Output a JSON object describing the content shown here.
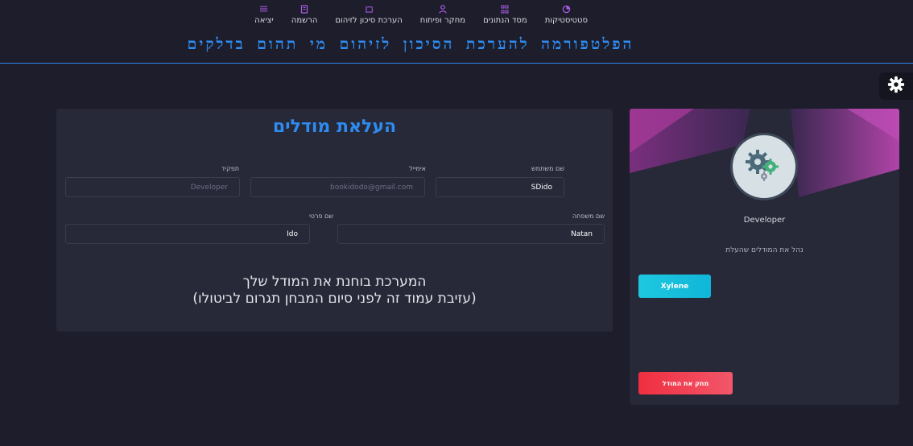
{
  "nav": {
    "items": [
      {
        "label": "סטטיסטיקות",
        "icon": "pie-chart-icon"
      },
      {
        "label": "מסד הנתונים",
        "icon": "database-icon"
      },
      {
        "label": "מחקר ופיתוח",
        "icon": "user-icon"
      },
      {
        "label": "הערכת סיכון לזיהום",
        "icon": "puzzle-icon"
      },
      {
        "label": "הרשמה",
        "icon": "book-icon"
      },
      {
        "label": "יציאה",
        "icon": "logout-icon"
      }
    ]
  },
  "header": {
    "title": "הפלטפורמה להערכת הסיכון לזיהום מי תהום בדלקים"
  },
  "form": {
    "title": "העלאת מודלים",
    "username_label": "שם משתמש",
    "username_value": "SDido",
    "email_label": "אימייל",
    "email_placeholder": "bookidodo@gmail.com",
    "role_label": "תפקיד",
    "role_placeholder": "Developer",
    "lastname_label": "שם משפחה",
    "lastname_value": "Natan",
    "firstname_label": "שם פרטי",
    "firstname_value": "Ido",
    "notice_line1": "המערכת בוחנת את המודל שלך",
    "notice_line2": "(עזיבת עמוד זה לפני סיום המבחן תגרום לביטולו)"
  },
  "profile": {
    "role": "Developer",
    "manage_text": "נהל את המודלים שהעלת",
    "model_button": "Xylene",
    "delete_button": "מחק את המודל"
  },
  "colors": {
    "accent": "#2e8cf0",
    "nav_icon": "#a95ce6",
    "panel": "#272838",
    "background": "#1d1d2b",
    "cyan_button": "#1ec8e0",
    "red_button": "#ef2f40"
  }
}
